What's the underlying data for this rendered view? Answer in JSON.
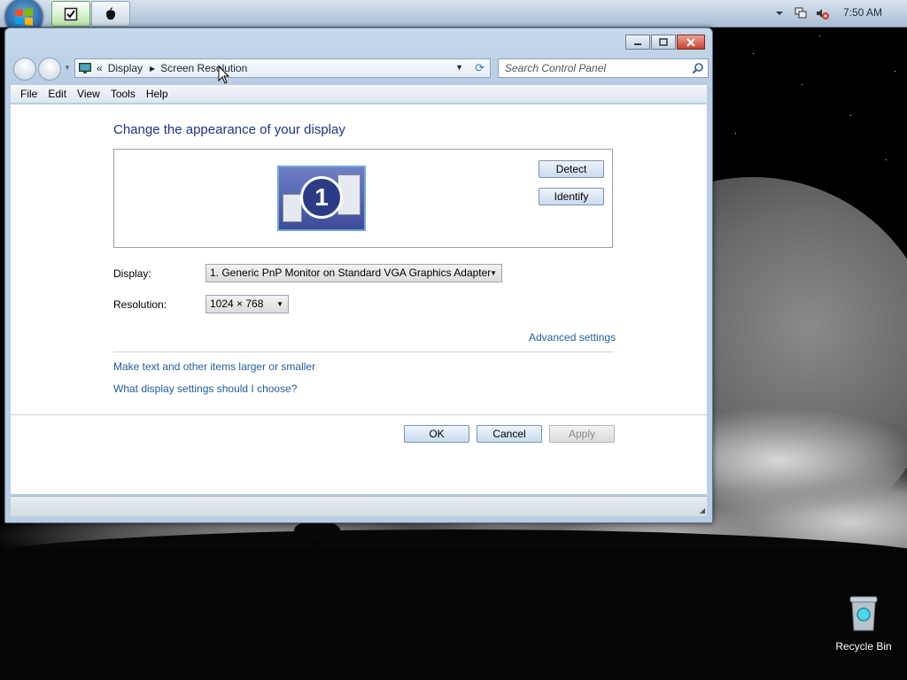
{
  "taskbar": {
    "clock": "7:50 AM",
    "start_icon": "windows-start-orb",
    "task_buttons": [
      {
        "icon": "checkbox-icon"
      },
      {
        "icon": "apple-icon"
      }
    ],
    "tray_icons": [
      "chevron-up-icon",
      "network-icon",
      "volume-muted-icon"
    ]
  },
  "window": {
    "address": {
      "overflow": "«",
      "crumbs": [
        "Display",
        "Screen Resolution"
      ]
    },
    "search_placeholder": "Search Control Panel",
    "menu": [
      "File",
      "Edit",
      "View",
      "Tools",
      "Help"
    ],
    "title": "Change the appearance of your display",
    "monitor_number": "1",
    "buttons": {
      "detect": "Detect",
      "identify": "Identify",
      "ok": "OK",
      "cancel": "Cancel",
      "apply": "Apply"
    },
    "fields": {
      "display_label": "Display:",
      "display_value": "1. Generic PnP Monitor on Standard VGA Graphics Adapter",
      "resolution_label": "Resolution:",
      "resolution_value": "1024 × 768"
    },
    "links": {
      "advanced": "Advanced settings",
      "larger": "Make text and other items larger or smaller",
      "choose": "What display settings should I choose?"
    }
  },
  "desktop": {
    "recycle_bin": "Recycle Bin"
  },
  "colors": {
    "title_text": "#1e3287",
    "link_text": "#1f5e9c",
    "close_button": "#c7432d"
  }
}
